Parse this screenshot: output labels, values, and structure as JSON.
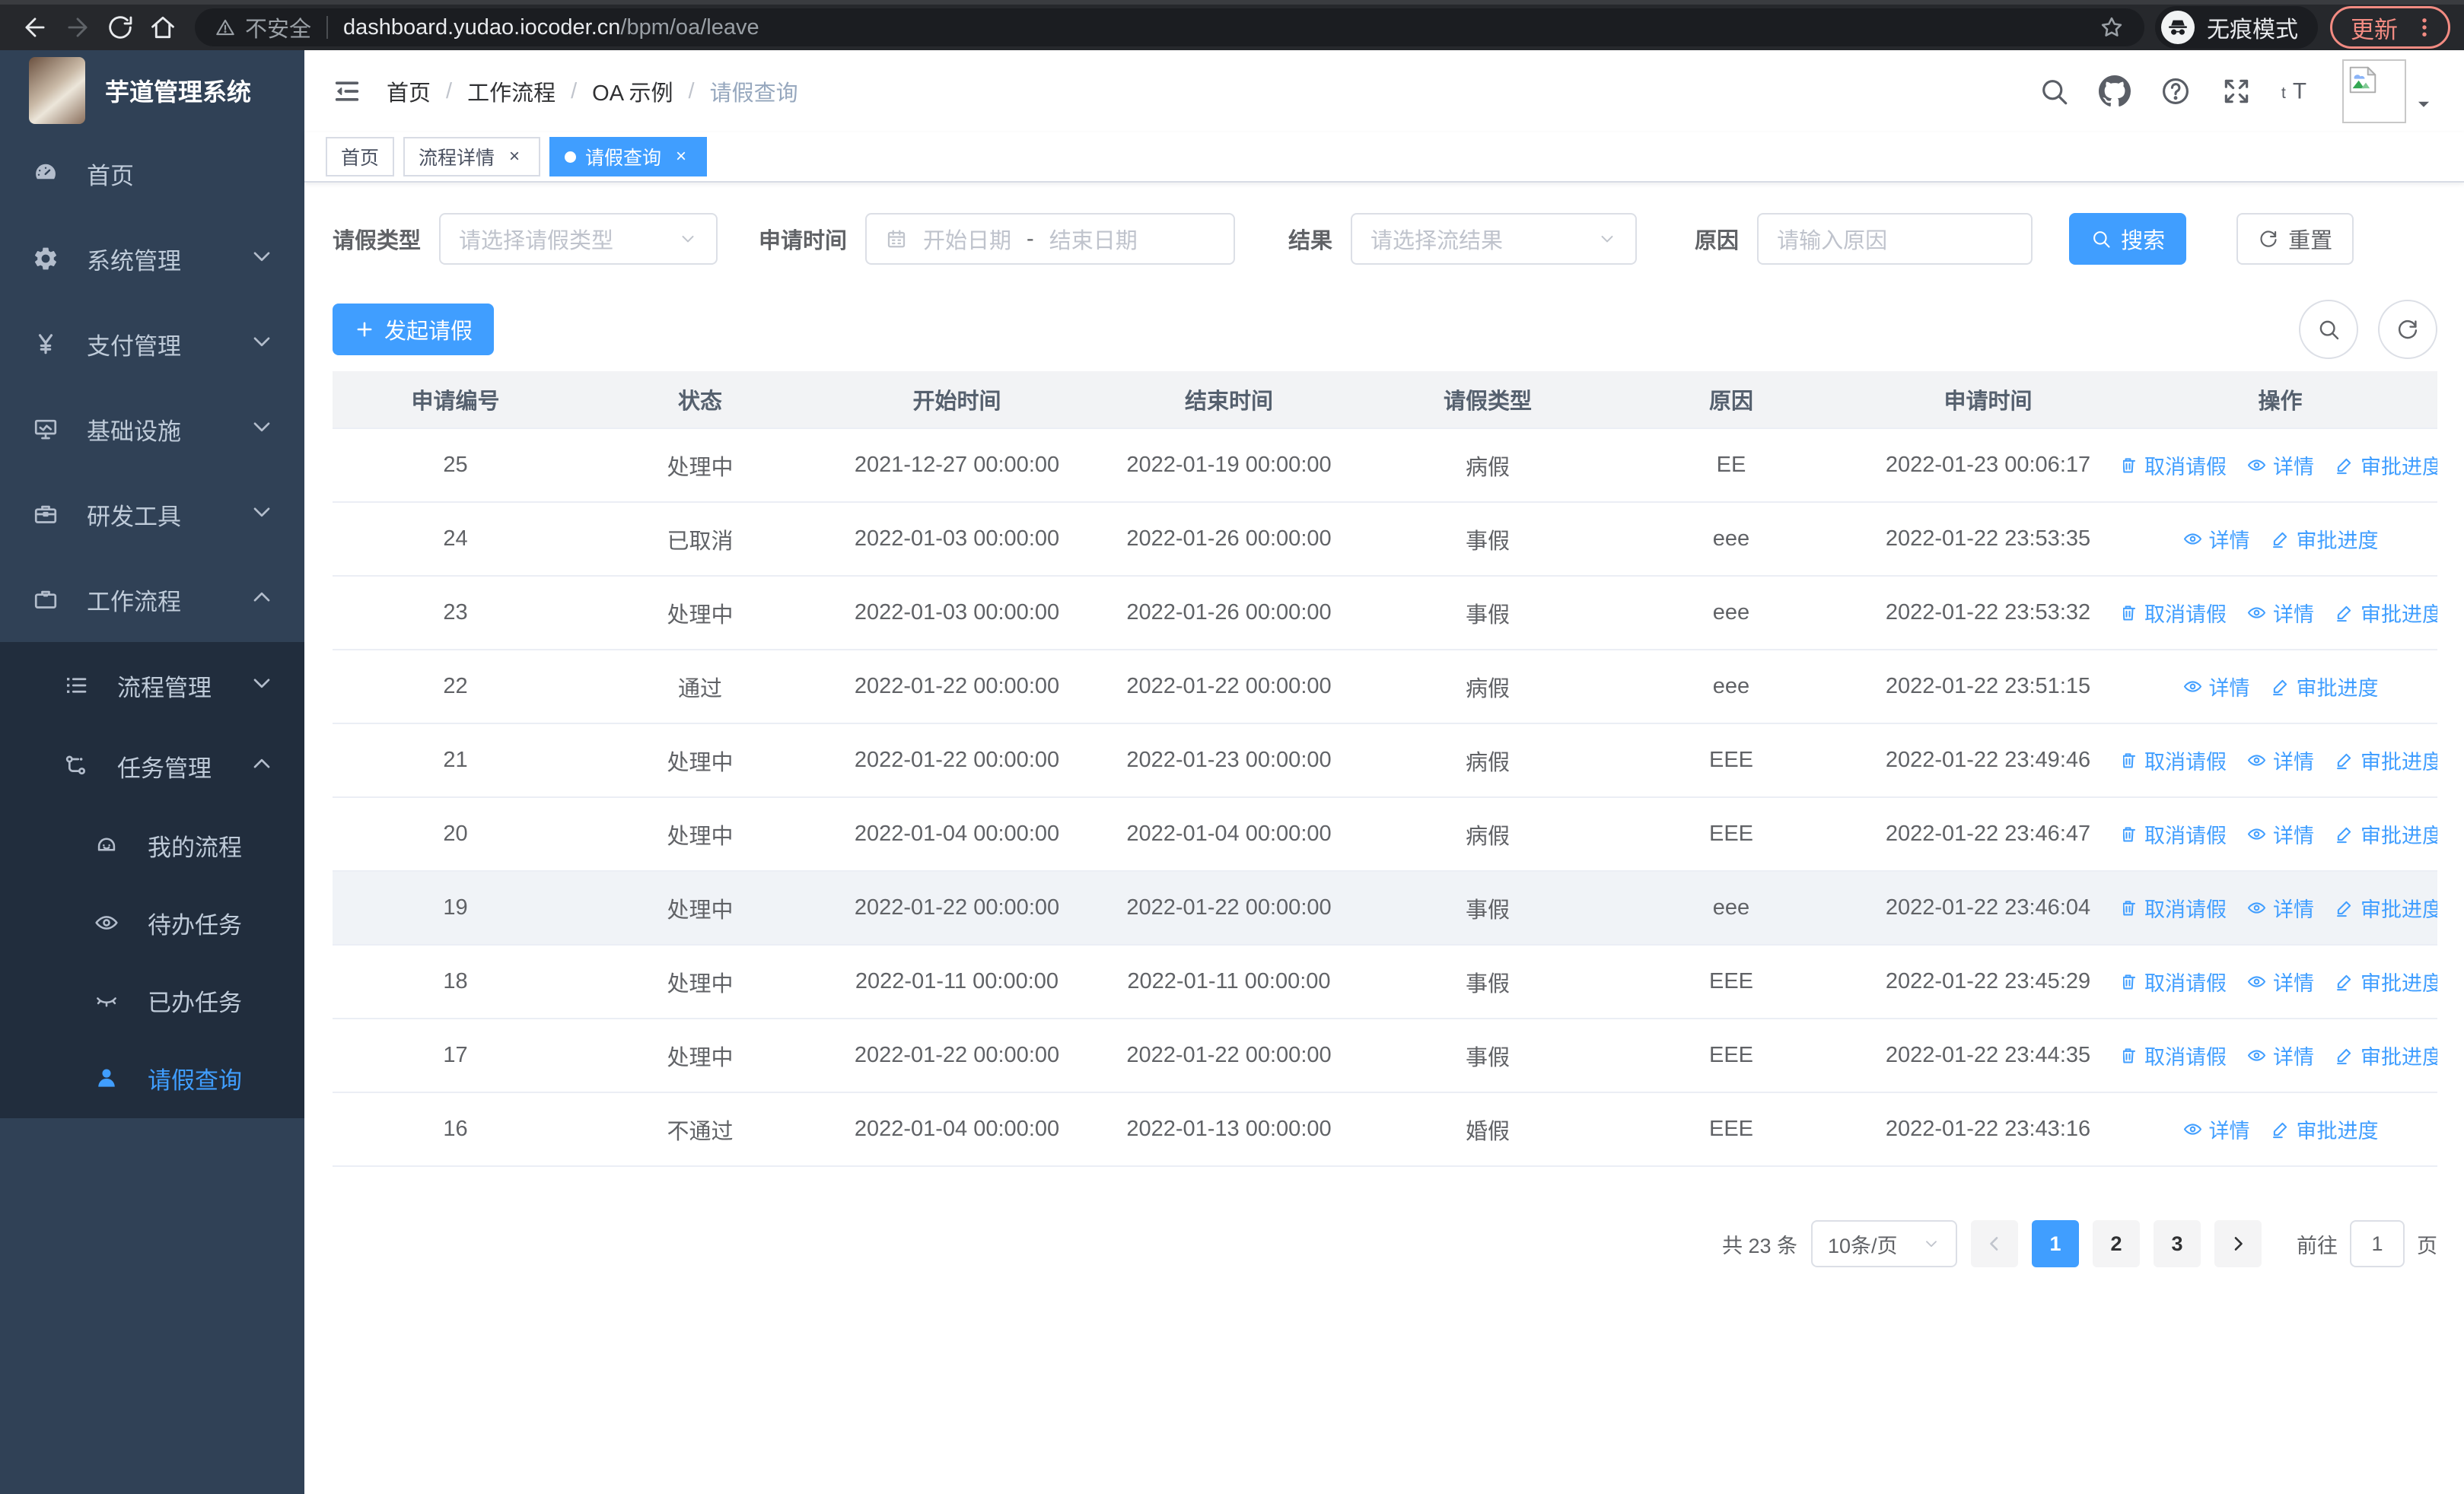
{
  "browser": {
    "security_label": "不安全",
    "url_host": "dashboard.yudao.iocoder.cn",
    "url_path": "/bpm/oa/leave",
    "incognito_label": "无痕模式",
    "update_label": "更新"
  },
  "sidebar": {
    "title": "芋道管理系统",
    "menu": [
      {
        "name": "home",
        "label": "首页",
        "icon": "dashboard-icon",
        "chevron": null
      },
      {
        "name": "system",
        "label": "系统管理",
        "icon": "gear-icon",
        "chevron": "down"
      },
      {
        "name": "payment",
        "label": "支付管理",
        "icon": "yen-icon",
        "chevron": "down"
      },
      {
        "name": "infra",
        "label": "基础设施",
        "icon": "monitor-icon",
        "chevron": "down"
      },
      {
        "name": "devtools",
        "label": "研发工具",
        "icon": "toolbox-icon",
        "chevron": "down"
      },
      {
        "name": "workflow",
        "label": "工作流程",
        "icon": "suitcase-icon",
        "chevron": "up"
      }
    ],
    "submenu": [
      {
        "name": "process-mgmt",
        "label": "流程管理",
        "icon": "flow-list-icon",
        "chevron": "down",
        "level": 1,
        "active": false
      },
      {
        "name": "task-mgmt",
        "label": "任务管理",
        "icon": "task-tree-icon",
        "chevron": "up",
        "level": 1,
        "active": false
      },
      {
        "name": "my-process",
        "label": "我的流程",
        "icon": "robot-icon",
        "chevron": null,
        "level": 2,
        "active": false
      },
      {
        "name": "todo-tasks",
        "label": "待办任务",
        "icon": "eye-open-icon",
        "chevron": null,
        "level": 2,
        "active": false
      },
      {
        "name": "done-tasks",
        "label": "已办任务",
        "icon": "eye-closed-icon",
        "chevron": null,
        "level": 2,
        "active": false
      },
      {
        "name": "leave-query",
        "label": "请假查询",
        "icon": "user-icon",
        "chevron": null,
        "level": 2,
        "active": true
      }
    ]
  },
  "header": {
    "breadcrumb": [
      "首页",
      "工作流程",
      "OA 示例",
      "请假查询"
    ],
    "icons": [
      "search-icon",
      "github-icon",
      "question-icon",
      "fullscreen-icon",
      "fontsize-icon"
    ]
  },
  "tabs": [
    {
      "label": "首页",
      "closable": false,
      "active": false
    },
    {
      "label": "流程详情",
      "closable": true,
      "active": false
    },
    {
      "label": "请假查询",
      "closable": true,
      "active": true
    }
  ],
  "filters": {
    "type_label": "请假类型",
    "type_placeholder": "请选择请假类型",
    "time_label": "申请时间",
    "start_placeholder": "开始日期",
    "range_separator": "-",
    "end_placeholder": "结束日期",
    "result_label": "结果",
    "result_placeholder": "请选择流结果",
    "reason_label": "原因",
    "reason_placeholder": "请输入原因",
    "search_label": "搜索",
    "reset_label": "重置"
  },
  "toolbar": {
    "create_label": "发起请假"
  },
  "table": {
    "columns": [
      "申请编号",
      "状态",
      "开始时间",
      "结束时间",
      "请假类型",
      "原因",
      "申请时间",
      "操作"
    ],
    "action_labels": {
      "cancel": "取消请假",
      "detail": "详情",
      "progress": "审批进度"
    },
    "rows": [
      {
        "id": "25",
        "status": "处理中",
        "start": "2021-12-27 00:00:00",
        "end": "2022-01-19 00:00:00",
        "type": "病假",
        "reason": "EE",
        "applied": "2022-01-23 00:06:17",
        "actions": [
          "cancel",
          "detail",
          "progress"
        ],
        "highlight": false
      },
      {
        "id": "24",
        "status": "已取消",
        "start": "2022-01-03 00:00:00",
        "end": "2022-01-26 00:00:00",
        "type": "事假",
        "reason": "eee",
        "applied": "2022-01-22 23:53:35",
        "actions": [
          "detail",
          "progress"
        ],
        "highlight": false
      },
      {
        "id": "23",
        "status": "处理中",
        "start": "2022-01-03 00:00:00",
        "end": "2022-01-26 00:00:00",
        "type": "事假",
        "reason": "eee",
        "applied": "2022-01-22 23:53:32",
        "actions": [
          "cancel",
          "detail",
          "progress"
        ],
        "highlight": false
      },
      {
        "id": "22",
        "status": "通过",
        "start": "2022-01-22 00:00:00",
        "end": "2022-01-22 00:00:00",
        "type": "病假",
        "reason": "eee",
        "applied": "2022-01-22 23:51:15",
        "actions": [
          "detail",
          "progress"
        ],
        "highlight": false
      },
      {
        "id": "21",
        "status": "处理中",
        "start": "2022-01-22 00:00:00",
        "end": "2022-01-23 00:00:00",
        "type": "病假",
        "reason": "EEE",
        "applied": "2022-01-22 23:49:46",
        "actions": [
          "cancel",
          "detail",
          "progress"
        ],
        "highlight": false
      },
      {
        "id": "20",
        "status": "处理中",
        "start": "2022-01-04 00:00:00",
        "end": "2022-01-04 00:00:00",
        "type": "病假",
        "reason": "EEE",
        "applied": "2022-01-22 23:46:47",
        "actions": [
          "cancel",
          "detail",
          "progress"
        ],
        "highlight": false
      },
      {
        "id": "19",
        "status": "处理中",
        "start": "2022-01-22 00:00:00",
        "end": "2022-01-22 00:00:00",
        "type": "事假",
        "reason": "eee",
        "applied": "2022-01-22 23:46:04",
        "actions": [
          "cancel",
          "detail",
          "progress"
        ],
        "highlight": true
      },
      {
        "id": "18",
        "status": "处理中",
        "start": "2022-01-11 00:00:00",
        "end": "2022-01-11 00:00:00",
        "type": "事假",
        "reason": "EEE",
        "applied": "2022-01-22 23:45:29",
        "actions": [
          "cancel",
          "detail",
          "progress"
        ],
        "highlight": false
      },
      {
        "id": "17",
        "status": "处理中",
        "start": "2022-01-22 00:00:00",
        "end": "2022-01-22 00:00:00",
        "type": "事假",
        "reason": "EEE",
        "applied": "2022-01-22 23:44:35",
        "actions": [
          "cancel",
          "detail",
          "progress"
        ],
        "highlight": false
      },
      {
        "id": "16",
        "status": "不通过",
        "start": "2022-01-04 00:00:00",
        "end": "2022-01-13 00:00:00",
        "type": "婚假",
        "reason": "EEE",
        "applied": "2022-01-22 23:43:16",
        "actions": [
          "detail",
          "progress"
        ],
        "highlight": false
      }
    ]
  },
  "pagination": {
    "total_label": "共 23 条",
    "page_size": "10条/页",
    "pages": [
      "1",
      "2",
      "3"
    ],
    "active_page": "1",
    "goto_label": "前往",
    "goto_value": "1",
    "goto_suffix": "页"
  },
  "colors": {
    "accent": "#409eff",
    "sidebar_bg": "#304156",
    "submenu_bg": "#212d3d",
    "update_accent": "#f28b82",
    "link": "#409eff"
  }
}
